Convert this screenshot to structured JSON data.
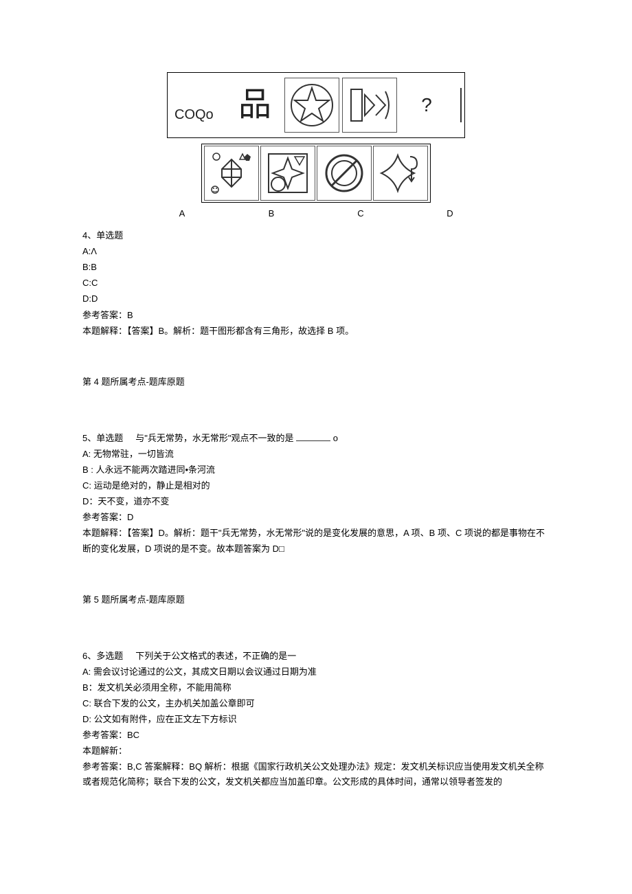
{
  "figure1": {
    "cell1_text": "COQo",
    "cell5_text": "?"
  },
  "answer_labels": {
    "a": "A",
    "b": "B",
    "c": "C",
    "d": "D"
  },
  "q4": {
    "header": "4、单选题",
    "optA": "A:Λ",
    "optB": "B:B",
    "optC": "C:C",
    "optD": "D:D",
    "ref_ans": "参考答案：B",
    "explain": "本题解释：【答案】B。解析：题干图形都含有三角形，故选择 B 项。",
    "footer": "第 4 题所属考点-题库原题"
  },
  "q5": {
    "header_pre": "5、单选题",
    "header_post": "与\"兵无常势，水无常形\"观点不一致的是",
    "header_suffix": "o",
    "optA": "A: 无物常驻，一切皆流",
    "optB": "B : 人永远不能两次踏进同•条河流",
    "optC": "C: 运动是绝对的，静止是相对的",
    "optD": "D：天不变，道亦不变",
    "ref_ans": "参考答案：D",
    "explain": "本题解释：【答案】D。解析：题干\"兵无常势，水无常形\"说的是变化发展的意思，A 项、B 项、C 项说的都是事物在不断的变化发展，D 项说的是不变。故本题答案为 D□",
    "footer": "第 5 题所属考点-题库原题"
  },
  "q6": {
    "header_pre": "6、多选题",
    "header_post": "下列关于公文格式的表述，不正确的是一",
    "optA": "A: 需会议讨论通过的公文，其成文日期以会议通过日期为准",
    "optB": "B：发文机关必须用全称，不能用简称",
    "optC": "C: 联合下发的公文，主办机关加盖公章即可",
    "optD": "D: 公文如有附件，应在正文左下方标识",
    "ref_ans": "参考答案：BC",
    "explain_label": "本题解新：",
    "explain": "参考答案：B,C 答案解释：BQ 解析：根据《国家行政机关公文处理办法》规定：发文机关标识应当使用发文机关全称或者规范化简称；联合下发的公文，发文机关都应当加盖印章。公文形成的具体时间，通常以领导者签发的"
  }
}
